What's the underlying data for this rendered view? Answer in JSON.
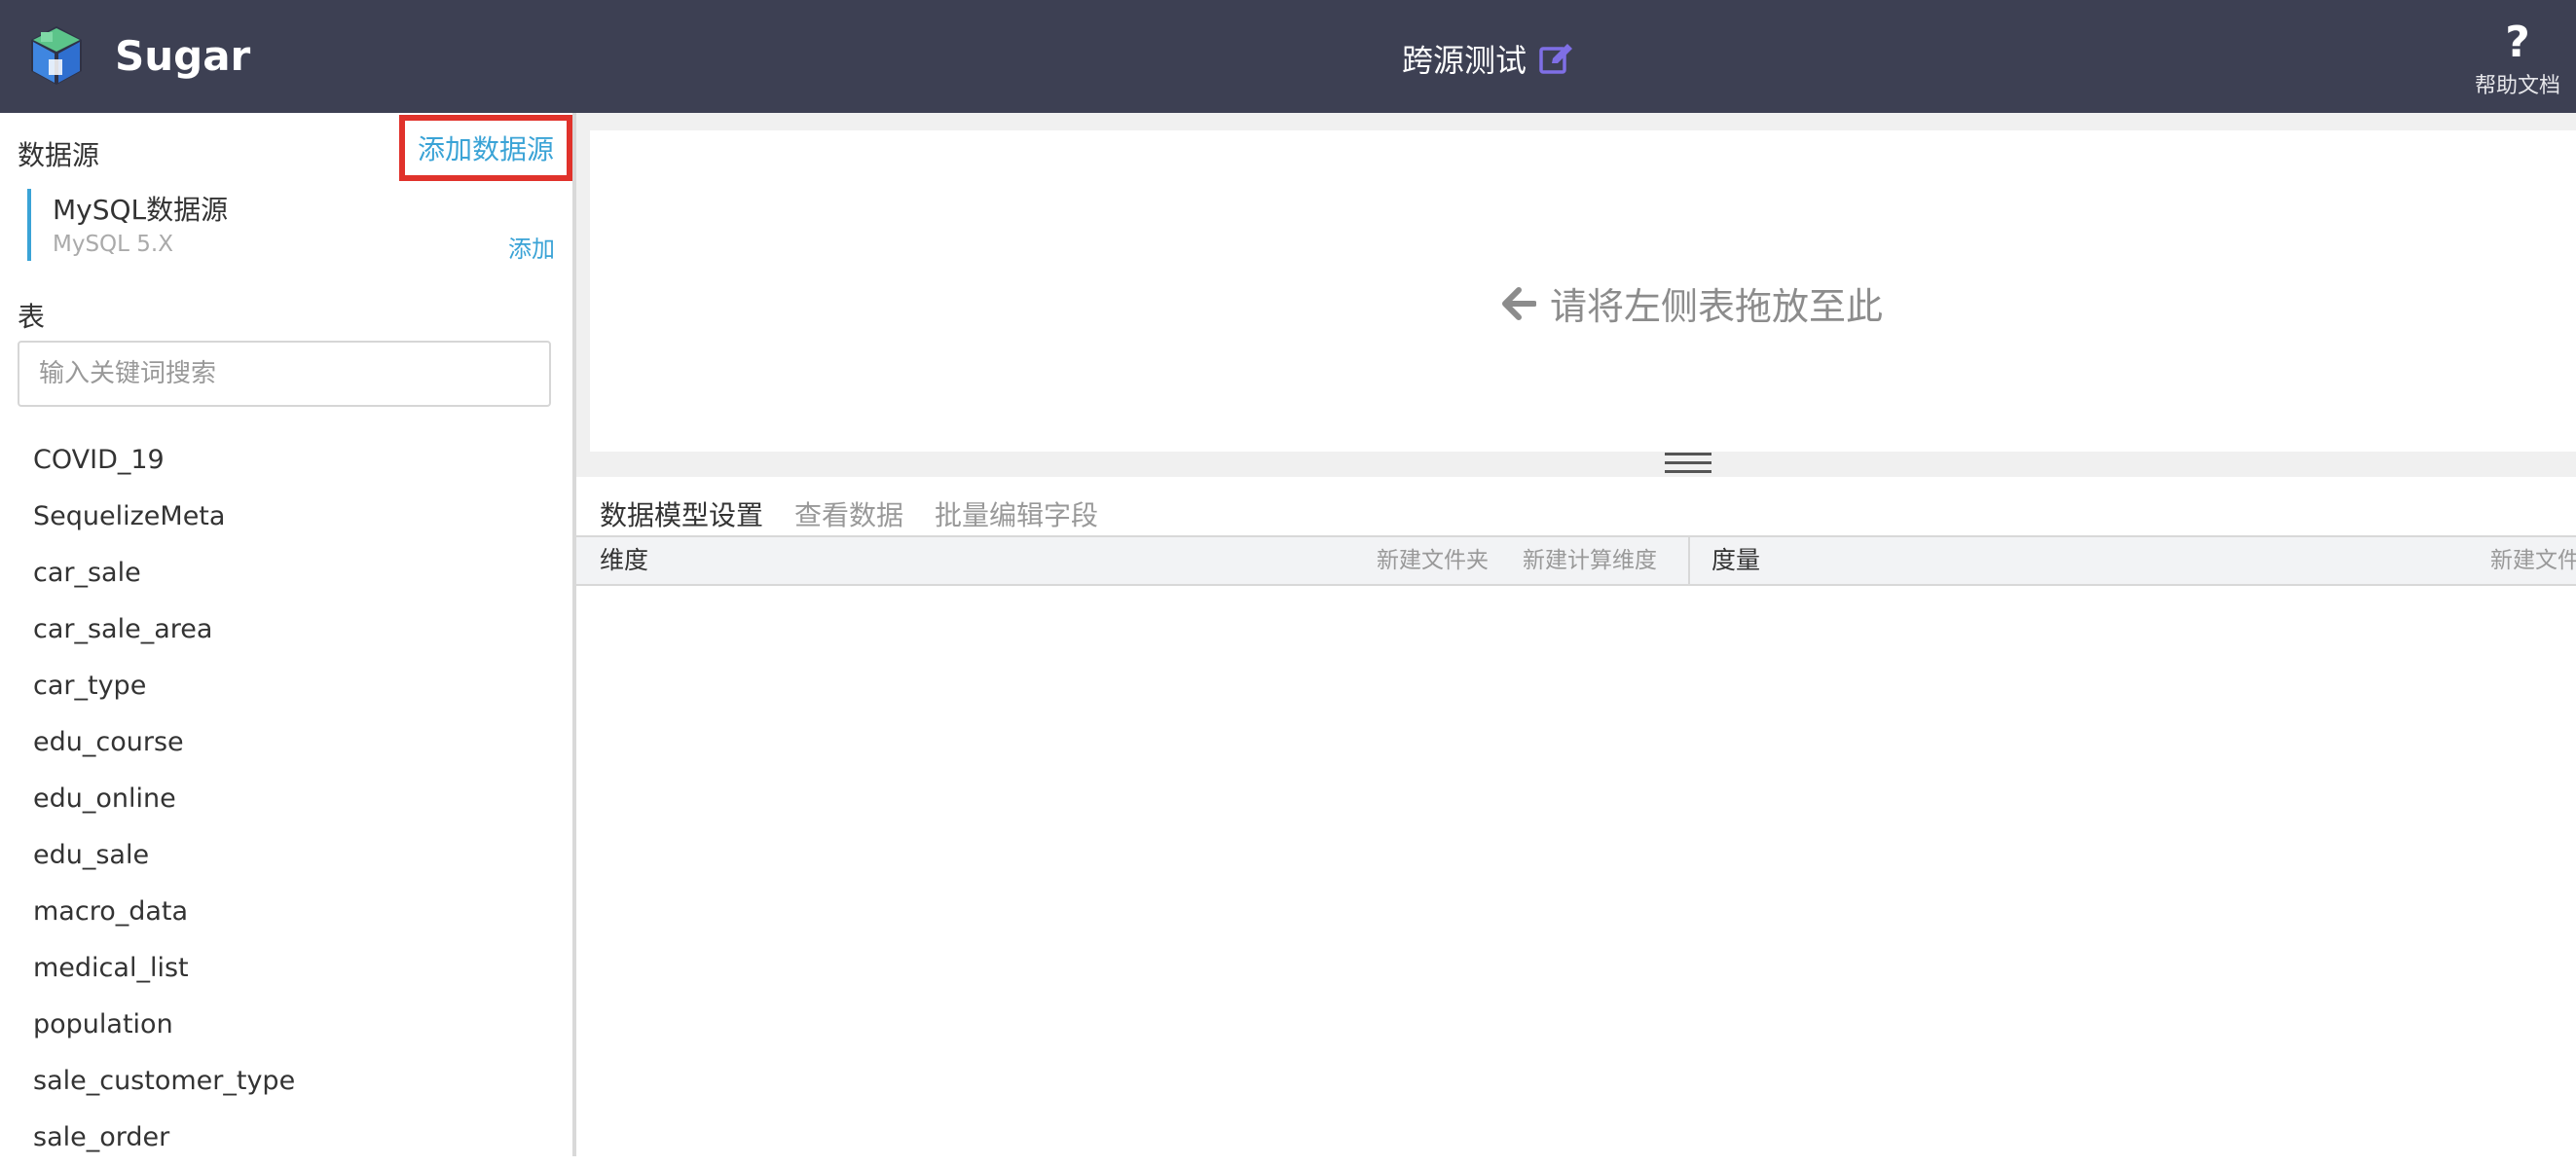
{
  "header": {
    "brand": "Sugar",
    "project_title": "跨源测试",
    "help_label": "帮助文档",
    "help_icon": "?"
  },
  "colors": {
    "header_bg": "#3d4053",
    "accent": "#3aa3d6",
    "highlight_box": "#e0322b",
    "edit_icon": "#7f6fe6"
  },
  "sidebar": {
    "datasource_title": "数据源",
    "add_datasource_label": "添加数据源",
    "datasource": {
      "name": "MySQL数据源",
      "version": "MySQL 5.X",
      "add_label": "添加"
    },
    "table_title": "表",
    "search_placeholder": "输入关键词搜索",
    "tables": [
      "COVID_19",
      "SequelizeMeta",
      "car_sale",
      "car_sale_area",
      "car_type",
      "edu_course",
      "edu_online",
      "edu_sale",
      "macro_data",
      "medical_list",
      "population",
      "sale_customer_type",
      "sale_order"
    ]
  },
  "main": {
    "drop_hint": "请将左侧表拖放至此",
    "tabs": [
      "数据模型设置",
      "查看数据",
      "批量编辑字段"
    ],
    "dimension_label": "维度",
    "new_folder_label": "新建文件夹",
    "new_calc_dimension_label": "新建计算维度",
    "measure_label": "度量",
    "measure_new_folder_label": "新建文件"
  }
}
